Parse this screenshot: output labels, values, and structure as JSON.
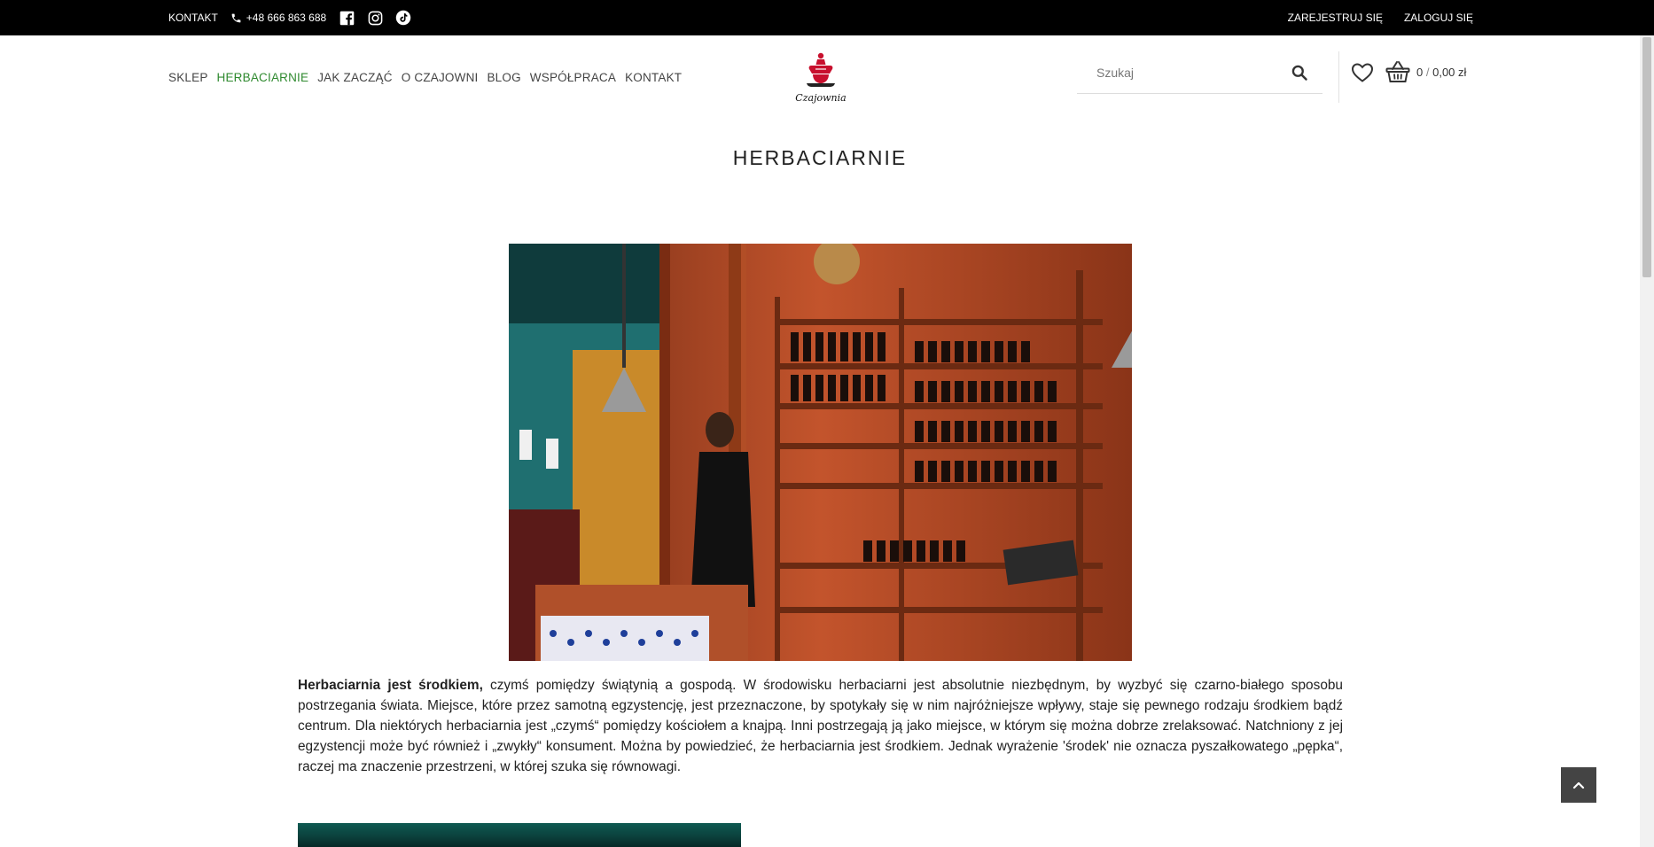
{
  "topbar": {
    "contact_label": "KONTAKT",
    "phone": "+48 666 863 688",
    "register_label": "ZAREJESTRUJ SIĘ",
    "login_label": "ZALOGUJ SIĘ"
  },
  "nav": {
    "items": [
      {
        "label": "SKLEP"
      },
      {
        "label": "HERBACIARNIE"
      },
      {
        "label": "JAK ZACZĄĆ"
      },
      {
        "label": "O CZAJOWNI"
      },
      {
        "label": "BLOG"
      },
      {
        "label": "WSPÓŁPRACA"
      },
      {
        "label": "KONTAKT"
      }
    ],
    "active": "HERBACIARNIE"
  },
  "logo": {
    "text": "Czajownia"
  },
  "search": {
    "placeholder": "Szukaj"
  },
  "cart": {
    "count": "0",
    "separator": "/",
    "total": "0,00 zł"
  },
  "page": {
    "title": "HERBACIARNIE",
    "intro_bold": "Herbaciarnia jest środkiem,",
    "intro_text": " czymś pomiędzy świątynią a gospodą. W środowisku herbaciarni jest absolutnie niezbędnym, by wyzbyć się czarno-białego sposobu postrzegania świata. Miejsce, które przez samotną egzystencję, jest przeznaczone, by spotykały się w nim najróżniejsze wpływy, staje się pewnego rodzaju środkiem bądź centrum. Dla niektórych herbaciarnia jest „czymś“ pomiędzy kościołem a knajpą. Inni postrzegają ją jako miejsce, w którym się można dobrze zrelaksować. Natchniony z jej egzystencji może być również i „zwykły“ konsument. Można by powiedzieć, że herbaciarnia jest środkiem. Jednak wyrażenie 'środek' nie oznacza pyszałkowatego „pępka“, raczej ma znaczenie przestrzeni, w której szuka się równowagi."
  },
  "colors": {
    "topbar_bg": "#000000",
    "nav_active": "#2f8a2f",
    "logo_red": "#c8102e",
    "totop_bg": "#444444"
  },
  "icons": [
    "phone-icon",
    "facebook-icon",
    "instagram-icon",
    "tiktok-icon",
    "search-icon",
    "heart-icon",
    "basket-icon",
    "chevron-up-icon"
  ]
}
